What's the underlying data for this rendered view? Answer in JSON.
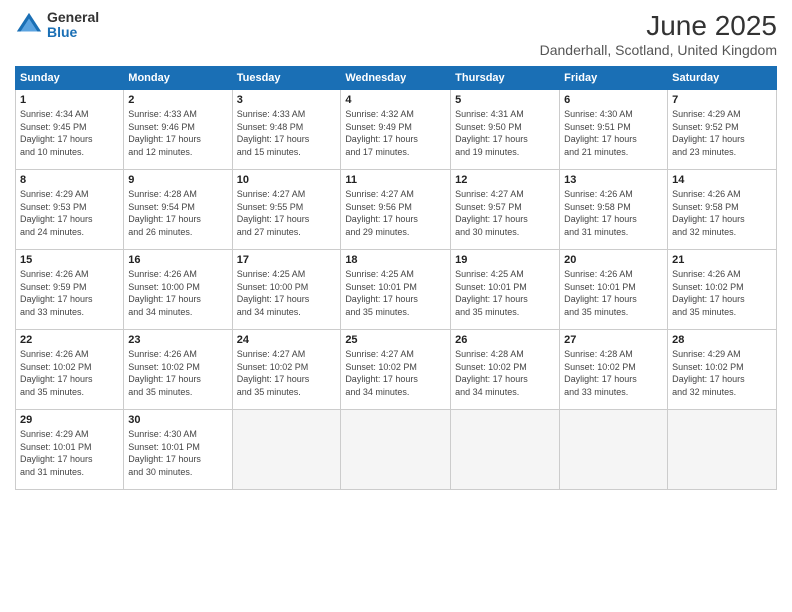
{
  "header": {
    "logo_general": "General",
    "logo_blue": "Blue",
    "month_year": "June 2025",
    "location": "Danderhall, Scotland, United Kingdom"
  },
  "weekdays": [
    "Sunday",
    "Monday",
    "Tuesday",
    "Wednesday",
    "Thursday",
    "Friday",
    "Saturday"
  ],
  "weeks": [
    [
      {
        "day": "1",
        "info": "Sunrise: 4:34 AM\nSunset: 9:45 PM\nDaylight: 17 hours\nand 10 minutes."
      },
      {
        "day": "2",
        "info": "Sunrise: 4:33 AM\nSunset: 9:46 PM\nDaylight: 17 hours\nand 12 minutes."
      },
      {
        "day": "3",
        "info": "Sunrise: 4:33 AM\nSunset: 9:48 PM\nDaylight: 17 hours\nand 15 minutes."
      },
      {
        "day": "4",
        "info": "Sunrise: 4:32 AM\nSunset: 9:49 PM\nDaylight: 17 hours\nand 17 minutes."
      },
      {
        "day": "5",
        "info": "Sunrise: 4:31 AM\nSunset: 9:50 PM\nDaylight: 17 hours\nand 19 minutes."
      },
      {
        "day": "6",
        "info": "Sunrise: 4:30 AM\nSunset: 9:51 PM\nDaylight: 17 hours\nand 21 minutes."
      },
      {
        "day": "7",
        "info": "Sunrise: 4:29 AM\nSunset: 9:52 PM\nDaylight: 17 hours\nand 23 minutes."
      }
    ],
    [
      {
        "day": "8",
        "info": "Sunrise: 4:29 AM\nSunset: 9:53 PM\nDaylight: 17 hours\nand 24 minutes."
      },
      {
        "day": "9",
        "info": "Sunrise: 4:28 AM\nSunset: 9:54 PM\nDaylight: 17 hours\nand 26 minutes."
      },
      {
        "day": "10",
        "info": "Sunrise: 4:27 AM\nSunset: 9:55 PM\nDaylight: 17 hours\nand 27 minutes."
      },
      {
        "day": "11",
        "info": "Sunrise: 4:27 AM\nSunset: 9:56 PM\nDaylight: 17 hours\nand 29 minutes."
      },
      {
        "day": "12",
        "info": "Sunrise: 4:27 AM\nSunset: 9:57 PM\nDaylight: 17 hours\nand 30 minutes."
      },
      {
        "day": "13",
        "info": "Sunrise: 4:26 AM\nSunset: 9:58 PM\nDaylight: 17 hours\nand 31 minutes."
      },
      {
        "day": "14",
        "info": "Sunrise: 4:26 AM\nSunset: 9:58 PM\nDaylight: 17 hours\nand 32 minutes."
      }
    ],
    [
      {
        "day": "15",
        "info": "Sunrise: 4:26 AM\nSunset: 9:59 PM\nDaylight: 17 hours\nand 33 minutes."
      },
      {
        "day": "16",
        "info": "Sunrise: 4:26 AM\nSunset: 10:00 PM\nDaylight: 17 hours\nand 34 minutes."
      },
      {
        "day": "17",
        "info": "Sunrise: 4:25 AM\nSunset: 10:00 PM\nDaylight: 17 hours\nand 34 minutes."
      },
      {
        "day": "18",
        "info": "Sunrise: 4:25 AM\nSunset: 10:01 PM\nDaylight: 17 hours\nand 35 minutes."
      },
      {
        "day": "19",
        "info": "Sunrise: 4:25 AM\nSunset: 10:01 PM\nDaylight: 17 hours\nand 35 minutes."
      },
      {
        "day": "20",
        "info": "Sunrise: 4:26 AM\nSunset: 10:01 PM\nDaylight: 17 hours\nand 35 minutes."
      },
      {
        "day": "21",
        "info": "Sunrise: 4:26 AM\nSunset: 10:02 PM\nDaylight: 17 hours\nand 35 minutes."
      }
    ],
    [
      {
        "day": "22",
        "info": "Sunrise: 4:26 AM\nSunset: 10:02 PM\nDaylight: 17 hours\nand 35 minutes."
      },
      {
        "day": "23",
        "info": "Sunrise: 4:26 AM\nSunset: 10:02 PM\nDaylight: 17 hours\nand 35 minutes."
      },
      {
        "day": "24",
        "info": "Sunrise: 4:27 AM\nSunset: 10:02 PM\nDaylight: 17 hours\nand 35 minutes."
      },
      {
        "day": "25",
        "info": "Sunrise: 4:27 AM\nSunset: 10:02 PM\nDaylight: 17 hours\nand 34 minutes."
      },
      {
        "day": "26",
        "info": "Sunrise: 4:28 AM\nSunset: 10:02 PM\nDaylight: 17 hours\nand 34 minutes."
      },
      {
        "day": "27",
        "info": "Sunrise: 4:28 AM\nSunset: 10:02 PM\nDaylight: 17 hours\nand 33 minutes."
      },
      {
        "day": "28",
        "info": "Sunrise: 4:29 AM\nSunset: 10:02 PM\nDaylight: 17 hours\nand 32 minutes."
      }
    ],
    [
      {
        "day": "29",
        "info": "Sunrise: 4:29 AM\nSunset: 10:01 PM\nDaylight: 17 hours\nand 31 minutes."
      },
      {
        "day": "30",
        "info": "Sunrise: 4:30 AM\nSunset: 10:01 PM\nDaylight: 17 hours\nand 30 minutes."
      },
      {
        "day": "",
        "info": ""
      },
      {
        "day": "",
        "info": ""
      },
      {
        "day": "",
        "info": ""
      },
      {
        "day": "",
        "info": ""
      },
      {
        "day": "",
        "info": ""
      }
    ]
  ]
}
